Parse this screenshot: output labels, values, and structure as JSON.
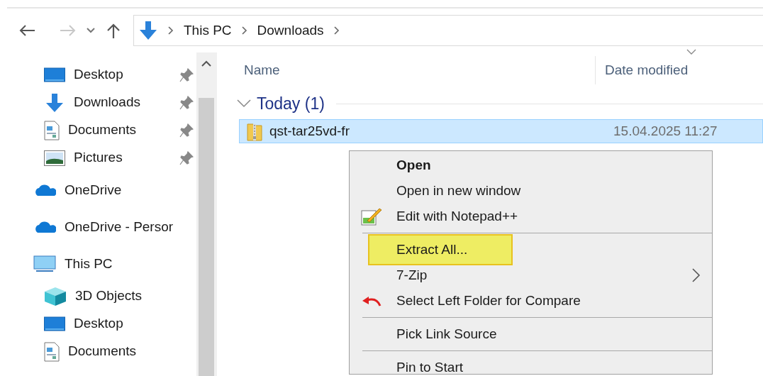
{
  "navigation": {
    "back": {
      "disabled": false
    },
    "forward": {
      "disabled": true
    },
    "address": [
      {
        "label": "This PC"
      },
      {
        "label": "Downloads"
      }
    ]
  },
  "sidebar": {
    "quick_access": [
      {
        "label": "Desktop",
        "kind": "desktop",
        "pinned": true
      },
      {
        "label": "Downloads",
        "kind": "download",
        "pinned": true
      },
      {
        "label": "Documents",
        "kind": "document",
        "pinned": true
      },
      {
        "label": "Pictures",
        "kind": "picture",
        "pinned": true
      }
    ],
    "tree": [
      {
        "label": "OneDrive",
        "kind": "cloud"
      },
      {
        "label": "OneDrive - Persor",
        "kind": "cloud"
      },
      {
        "label": "This PC",
        "kind": "monitor",
        "children": [
          {
            "label": "3D Objects",
            "kind": "cube"
          },
          {
            "label": "Desktop",
            "kind": "desktop"
          },
          {
            "label": "Documents",
            "kind": "document"
          }
        ]
      }
    ]
  },
  "file_list": {
    "columns": [
      {
        "label": "Name"
      },
      {
        "label": "Date modified",
        "sorted": true
      }
    ],
    "groups": [
      {
        "label": "Today (1)",
        "expanded": true,
        "rows": [
          {
            "name": "qst-tar25vd-fr",
            "date_modified": "15.04.2025 11:27",
            "selected": true
          }
        ]
      }
    ]
  },
  "context_menu": {
    "items": [
      {
        "kind": "command",
        "label": "Open",
        "default": true,
        "highlighted": false
      },
      {
        "kind": "command",
        "label": "Open in new window",
        "default": false,
        "highlighted": false
      },
      {
        "kind": "notepad-command",
        "label": "Edit with Notepad++",
        "default": false,
        "highlighted": false
      },
      {
        "kind": "separator"
      },
      {
        "kind": "command",
        "label": "Extract All...",
        "default": false,
        "highlighted": true
      },
      {
        "kind": "submenu",
        "label": "7-Zip",
        "default": false,
        "highlighted": false
      },
      {
        "kind": "compare-command",
        "label": "Select Left Folder for Compare",
        "default": false,
        "highlighted": false
      },
      {
        "kind": "separator"
      },
      {
        "kind": "command",
        "label": "Pick Link Source",
        "default": false,
        "highlighted": false
      },
      {
        "kind": "separator"
      },
      {
        "kind": "command",
        "label": "Pin to Start",
        "default": false,
        "highlighted": false
      }
    ]
  }
}
